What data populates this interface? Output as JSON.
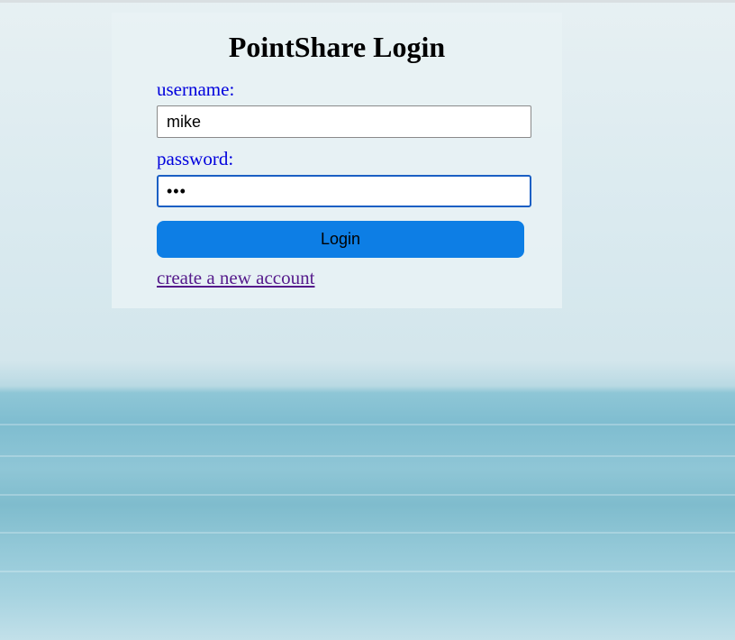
{
  "login": {
    "title": "PointShare Login",
    "username_label": "username:",
    "username_value": "mike",
    "password_label": "password:",
    "password_masked": "•••",
    "login_button": "Login",
    "create_account_link": "create a new account"
  },
  "colors": {
    "label_text": "#0000dd",
    "button_background": "#0d7ee5",
    "link_visited": "#551a8b",
    "focus_border": "#1a5fc4"
  }
}
